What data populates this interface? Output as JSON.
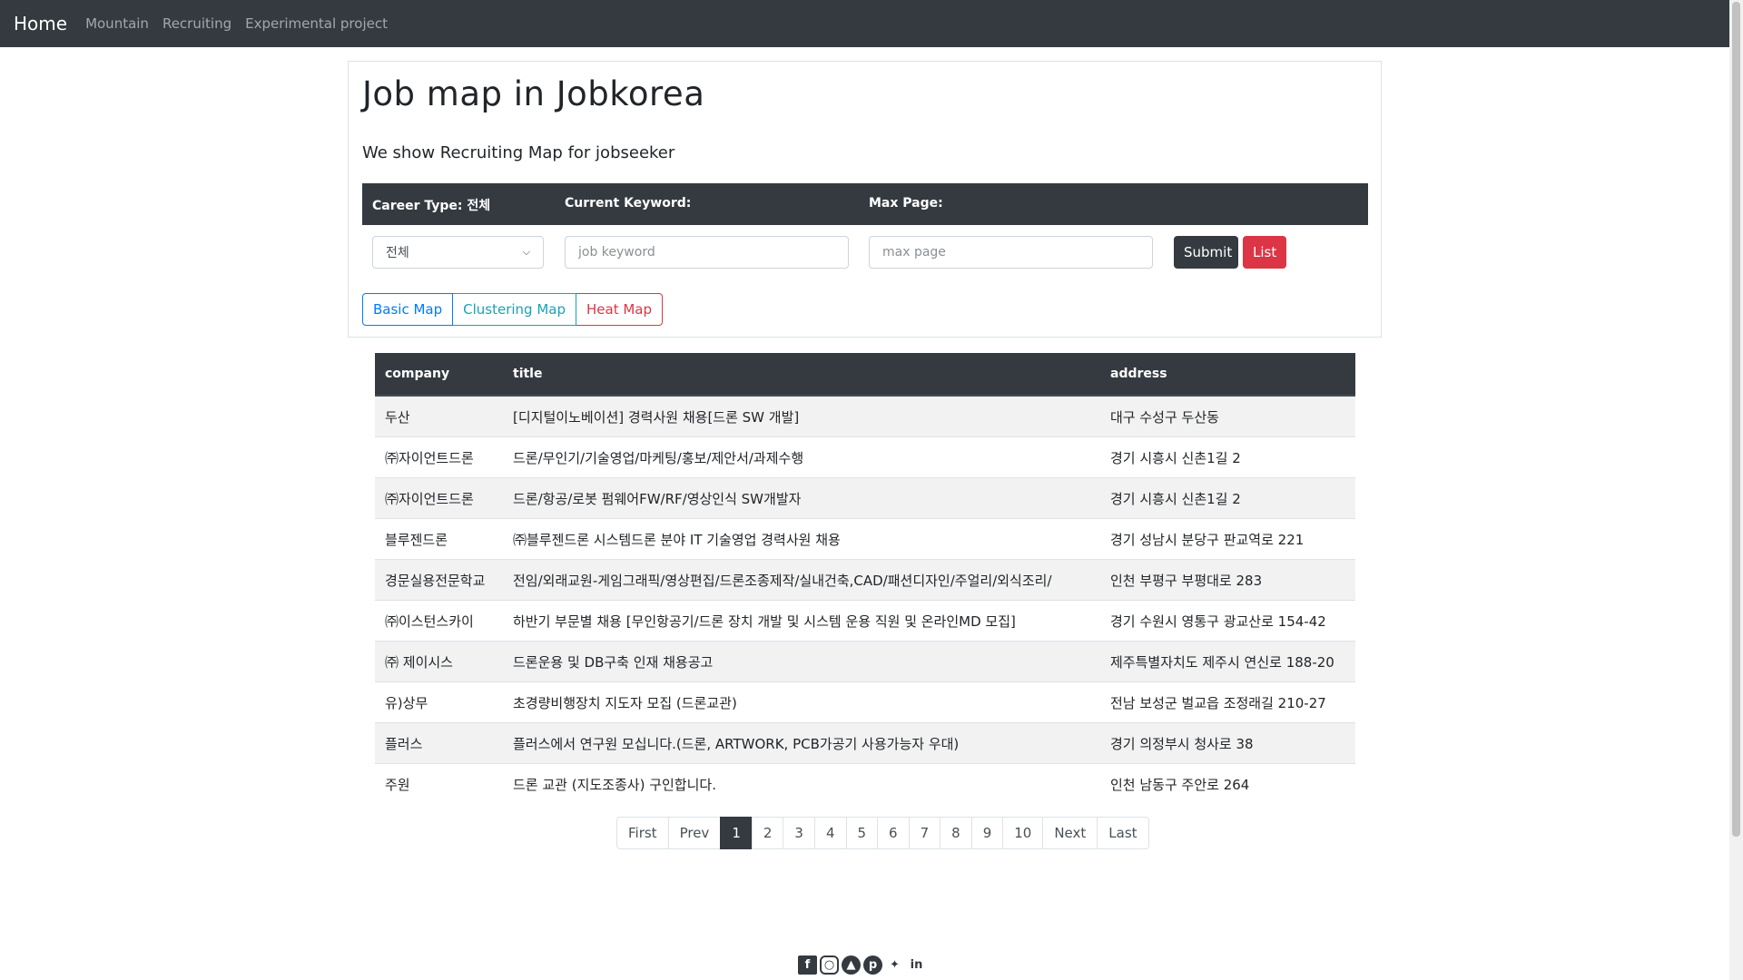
{
  "navbar": {
    "brand": "Home",
    "links": [
      "Mountain",
      "Recruiting",
      "Experimental project"
    ]
  },
  "header": {
    "title": "Job map in Jobkorea",
    "subtitle": "We show Recruiting Map for jobseeker"
  },
  "form": {
    "career_label": "Career Type: 전체",
    "keyword_label": "Current Keyword:",
    "maxpage_label": "Max Page:",
    "career_value": "전체",
    "keyword_placeholder": "job keyword",
    "maxpage_placeholder": "max page",
    "submit": "Submit",
    "list": "List"
  },
  "map_buttons": [
    "Basic Map",
    "Clustering Map",
    "Heat Map"
  ],
  "table": {
    "columns": [
      "company",
      "title",
      "address"
    ],
    "rows": [
      [
        "두산",
        "[디지털이노베이션] 경력사원 채용[드론 SW 개발]",
        "대구 수성구 두산동"
      ],
      [
        "㈜자이언트드론",
        "드론/무인기/기술영업/마케팅/홍보/제안서/과제수행",
        "경기 시흥시 신촌1길 2"
      ],
      [
        "㈜자이언트드론",
        "드론/항공/로봇 펌웨어FW/RF/영상인식 SW개발자",
        "경기 시흥시 신촌1길 2"
      ],
      [
        "블루젠드론",
        "㈜블루젠드론 시스템드론 분야 IT 기술영업 경력사원 채용",
        "경기 성남시 분당구 판교역로 221"
      ],
      [
        "경문실용전문학교",
        "전임/외래교원-게임그래픽/영상편집/드론조종제작/실내건축,CAD/패션디자인/주얼리/외식조리/",
        "인천 부평구 부평대로 283"
      ],
      [
        "㈜이스턴스카이",
        "하반기 부문별 채용 [무인항공기/드론 장치 개발 및 시스템 운용 직원 및 온라인MD 모집]",
        "경기 수원시 영통구 광교산로 154-42"
      ],
      [
        "㈜ 제이시스",
        "드론운용 및 DB구축 인재 채용공고",
        "제주특별자치도 제주시 연신로 188-20"
      ],
      [
        "유)상무",
        "초경량비행장치 지도자 모집 (드론교관)",
        "전남 보성군 벌교읍 조정래길 210-27"
      ],
      [
        "플러스",
        "플러스에서 연구원 모십니다.(드론, ARTWORK, PCB가공기 사용가능자 우대)",
        "경기 의정부시 청사로 38"
      ],
      [
        "주원",
        "드론 교관 (지도조종사) 구인합니다.",
        "인천 남동구 주안로 264"
      ]
    ]
  },
  "pagination": {
    "first": "First",
    "prev": "Prev",
    "pages": [
      "1",
      "2",
      "3",
      "4",
      "5",
      "6",
      "7",
      "8",
      "9",
      "10"
    ],
    "active": "1",
    "next": "Next",
    "last": "Last"
  },
  "footer": {
    "icons": [
      "facebook-icon",
      "instagram-icon",
      "snapchat-icon",
      "pinterest-icon",
      "twitter-icon",
      "linkedin-icon"
    ]
  }
}
